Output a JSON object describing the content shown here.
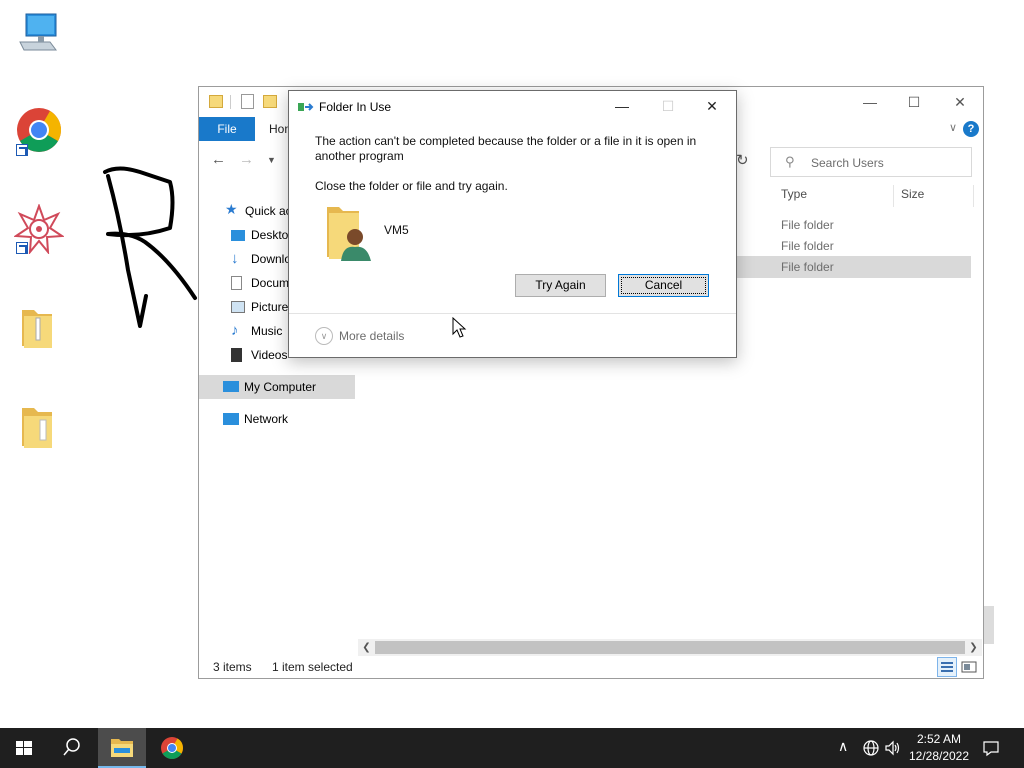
{
  "desktop": {
    "icons": [
      "computer-icon",
      "chrome-icon",
      "mandala-icon",
      "zip-folder-icon",
      "folder-icon"
    ]
  },
  "explorer": {
    "tabs": {
      "file": "File",
      "home": "Hon"
    },
    "search_placeholder": "Search Users",
    "nav": {
      "quick_access": "Quick ac",
      "desktop": "Deskto",
      "downloads": "Downlo",
      "documents": "Docum",
      "pictures": "Picture",
      "music": "Music",
      "videos": "Videos",
      "my_computer": "My Computer",
      "network": "Network"
    },
    "columns": {
      "type": "Type",
      "size": "Size"
    },
    "rows": [
      {
        "type": "File folder"
      },
      {
        "type": "File folder"
      },
      {
        "type": "File folder"
      }
    ],
    "status": {
      "items": "3 items",
      "selected": "1 item selected"
    }
  },
  "dialog": {
    "title": "Folder In Use",
    "message_line1": "The action can't be completed because the folder or a file in it is open in",
    "message_line2": "another program",
    "instruction": "Close the folder or file and try again.",
    "item_name": "VM5",
    "try_again": "Try Again",
    "cancel": "Cancel",
    "more_details": "More details"
  },
  "taskbar": {
    "time": "2:52 AM",
    "date": "12/28/2022"
  },
  "colors": {
    "accent": "#1979ca",
    "taskbar": "#1f1f1f"
  }
}
